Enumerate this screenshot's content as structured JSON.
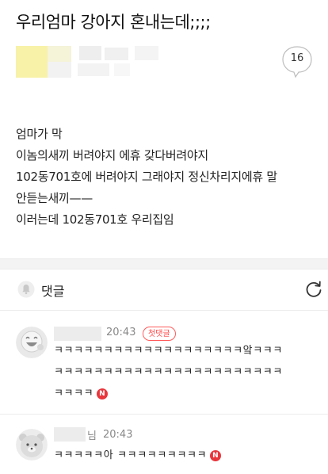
{
  "post": {
    "title": "우리엄마 강아지 혼내는데;;;;",
    "comment_count": "16",
    "body_lines": [
      "엄마가 막",
      "이놈의새끼 버려야지 에휴 갖다버려야지",
      "102동701호에 버려야지 그래야지 정신차리지에휴 말",
      "안듣는새끼——",
      "이러는데 102동701호 우리집임"
    ]
  },
  "comments_section": {
    "title": "댓글",
    "icons": {
      "header": "bell-icon",
      "refresh": "refresh-icon"
    }
  },
  "comments": [
    {
      "time": "20:43",
      "badge": "첫댓글",
      "lines": [
        "ㅋㅋㅋㅋㅋㅋㅋㅋㅋㅋㅋㅋㅋㅋㅋㅋㅋㅋㅋ앜ㅋㅋㅋ",
        "ㅋㅋㅋㅋㅋㅋㅋㅋㅋㅋㅋㅋㅋㅋㅋㅋㅋㅋㅋㅋㅋㅋㅋ",
        "ㅋㅋㅋㅋ"
      ],
      "new_badge": "N"
    },
    {
      "name_fragment": "님",
      "time": "20:43",
      "lines": [
        "ㅋㅋㅋㅋㅋ아 ㅋㅋㅋㅋㅋㅋㅋㅋㅋ"
      ],
      "new_badge": "N"
    }
  ],
  "colors": {
    "accent_red": "#e8363c",
    "badge_border": "#ff5b5b",
    "separator": "#f3f3f3"
  }
}
